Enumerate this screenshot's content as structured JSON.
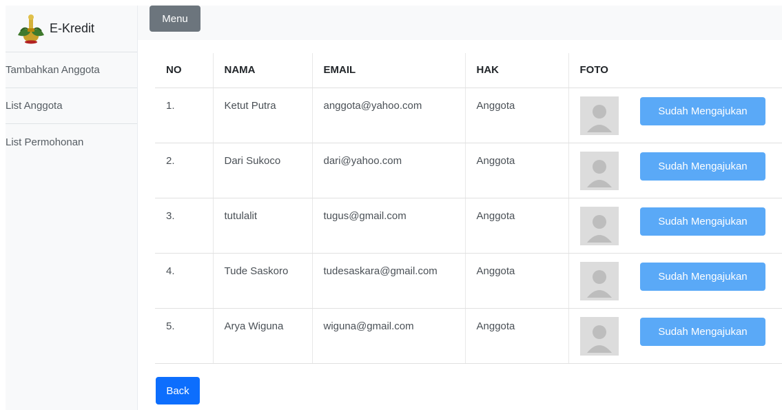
{
  "brand": {
    "title": "E-Kredit",
    "logo_icon": "emblem-logo-icon"
  },
  "sidebar": {
    "items": [
      {
        "label": "Tambahkan Anggota"
      },
      {
        "label": "List Anggota"
      },
      {
        "label": "List Permohonan"
      }
    ]
  },
  "topbar": {
    "menu_label": "Menu"
  },
  "table": {
    "headers": {
      "no": "NO",
      "nama": "NAMA",
      "email": "EMAIL",
      "hak": "HAK",
      "foto": "FOTO"
    },
    "rows": [
      {
        "no": "1.",
        "nama": "Ketut Putra",
        "email": "anggota@yahoo.com",
        "hak": "Anggota",
        "foto_icon": "user-avatar-icon",
        "action": "Sudah Mengajukan"
      },
      {
        "no": "2.",
        "nama": "Dari Sukoco",
        "email": "dari@yahoo.com",
        "hak": "Anggota",
        "foto_icon": "user-avatar-icon",
        "action": "Sudah Mengajukan"
      },
      {
        "no": "3.",
        "nama": "tutulalit",
        "email": "tugus@gmail.com",
        "hak": "Anggota",
        "foto_icon": "user-avatar-icon",
        "action": "Sudah Mengajukan"
      },
      {
        "no": "4.",
        "nama": "Tude Saskoro",
        "email": "tudesaskara@gmail.com",
        "hak": "Anggota",
        "foto_icon": "user-avatar-icon",
        "action": "Sudah Mengajukan"
      },
      {
        "no": "5.",
        "nama": "Arya Wiguna",
        "email": "wiguna@gmail.com",
        "hak": "Anggota",
        "foto_icon": "user-avatar-icon",
        "action": "Sudah Mengajukan"
      }
    ]
  },
  "footer": {
    "back_label": "Back"
  },
  "colors": {
    "primary": "#0d6efd",
    "action_button": "#5aa9f7",
    "menu_button": "#6c757d",
    "sidebar_bg": "#f8f9fa"
  }
}
